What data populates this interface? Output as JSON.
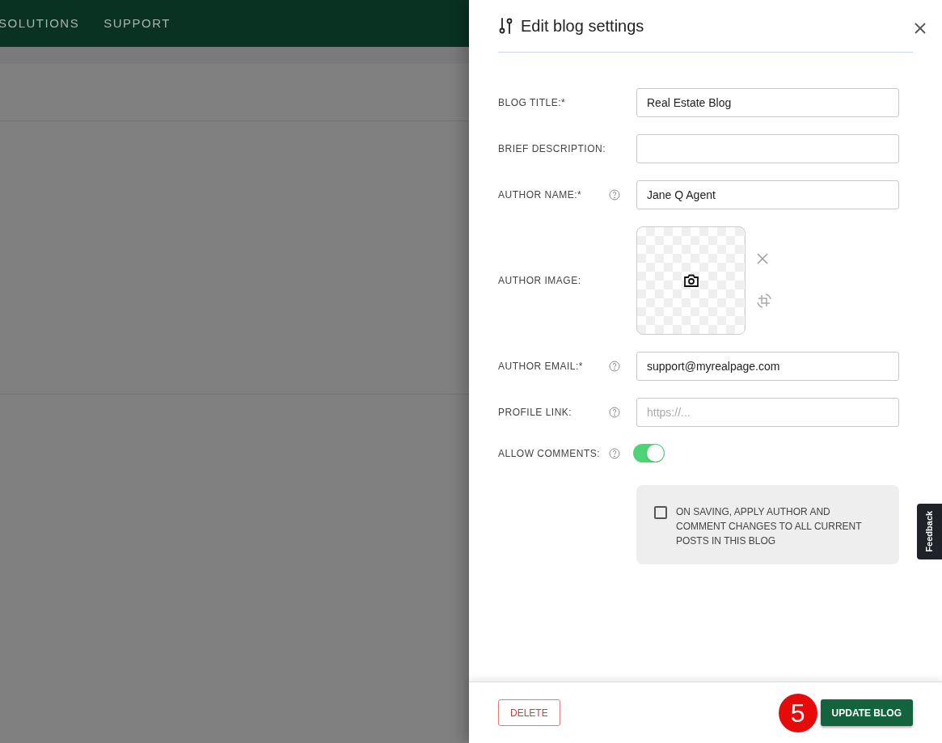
{
  "nav": {
    "items": [
      "SOLUTIONS",
      "SUPPORT"
    ]
  },
  "panel": {
    "title": "Edit blog settings",
    "fields": [
      {
        "kind": "text",
        "label": "BLOG TITLE:*",
        "help": false,
        "value": "Real Estate Blog"
      },
      {
        "kind": "text",
        "label": "BRIEF DESCRIPTION:",
        "help": false
      },
      {
        "kind": "text",
        "label": "AUTHOR NAME:*",
        "help": true,
        "value": "Jane Q Agent"
      },
      {
        "kind": "image",
        "label": "AUTHOR IMAGE:",
        "help": false
      },
      {
        "kind": "text",
        "label": "AUTHOR EMAIL:*",
        "help": true,
        "value": "support@myrealpage.com"
      },
      {
        "kind": "text",
        "label": "PROFILE LINK:",
        "help": true,
        "placeholder": "https://..."
      },
      {
        "kind": "toggle",
        "label": "ALLOW COMMENTS:",
        "help": true,
        "on": true
      }
    ],
    "apply_all": {
      "label": "ON SAVING, APPLY AUTHOR AND COMMENT CHANGES TO ALL CURRENT POSTS IN THIS BLOG",
      "checked": false
    },
    "delete_button": "DELETE",
    "step_badge": "5",
    "update_button": "UPDATE BLOG"
  },
  "feedback_tab": "Feedback"
}
